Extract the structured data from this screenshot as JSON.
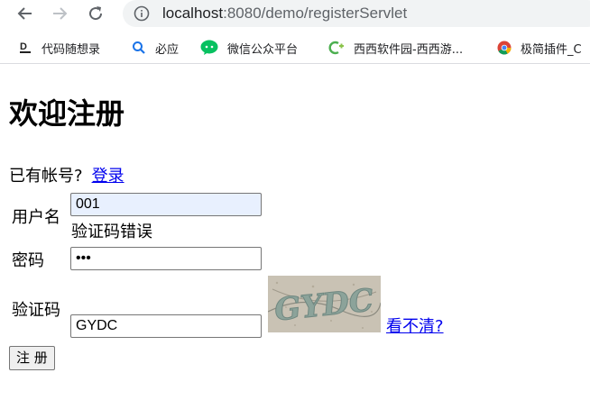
{
  "browser": {
    "url_host": "localhost",
    "url_rest": ":8080/demo/registerServlet",
    "bookmarks": [
      {
        "label": "代码随想录",
        "icon": "code-book-icon"
      },
      {
        "label": "必应",
        "icon": "bing-search-icon"
      },
      {
        "label": "微信公众平台",
        "icon": "wechat-icon"
      },
      {
        "label": "西西软件园-西西游...",
        "icon": "cr173-icon"
      },
      {
        "label": "极简插件_C",
        "icon": "chrome-icon"
      }
    ]
  },
  "page": {
    "title": "欢迎注册",
    "login_prompt": "已有帐号?",
    "login_link": "登录",
    "username_label": "用户名",
    "username_value": "001",
    "error_message": "验证码错误",
    "password_label": "密码",
    "password_value": "•••",
    "captcha_label": "验证码",
    "captcha_value": "GYDC",
    "captcha_image_text": "GYDC",
    "refresh_link": "看不清? ",
    "submit_label": "注 册"
  },
  "colors": {
    "link": "#0000ee",
    "autofill_bg": "#e8f0fe",
    "omnibox_bg": "#f1f3f4"
  }
}
